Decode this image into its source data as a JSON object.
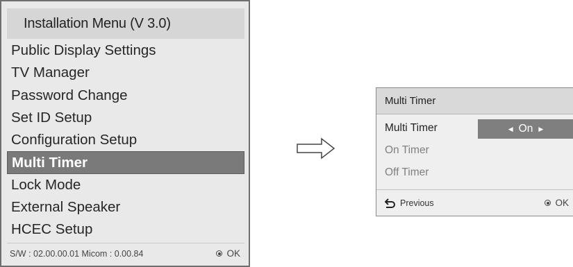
{
  "installation_menu": {
    "title": "Installation Menu (V 3.0)",
    "items": [
      {
        "label": "Public Display Settings"
      },
      {
        "label": "TV Manager"
      },
      {
        "label": "Password Change"
      },
      {
        "label": "Set ID Setup"
      },
      {
        "label": "Configuration Setup"
      },
      {
        "label": "Multi Timer",
        "selected": true
      },
      {
        "label": "Lock Mode"
      },
      {
        "label": "External Speaker"
      },
      {
        "label": "HCEC Setup"
      }
    ],
    "footer": {
      "version": "S/W : 02.00.00.01 Micom : 0.00.84",
      "ok_label": "OK"
    }
  },
  "multi_timer_panel": {
    "title": "Multi Timer",
    "rows": [
      {
        "label": "Multi Timer",
        "value": "On",
        "enabled": true
      },
      {
        "label": "On Timer",
        "enabled": false
      },
      {
        "label": "Off Timer",
        "enabled": false
      }
    ],
    "footer": {
      "previous_label": "Previous",
      "ok_label": "OK"
    }
  },
  "colors": {
    "selected_bg": "#7a7a7a",
    "panel_bg": "#e9e9e9",
    "disabled_text": "#808080"
  }
}
